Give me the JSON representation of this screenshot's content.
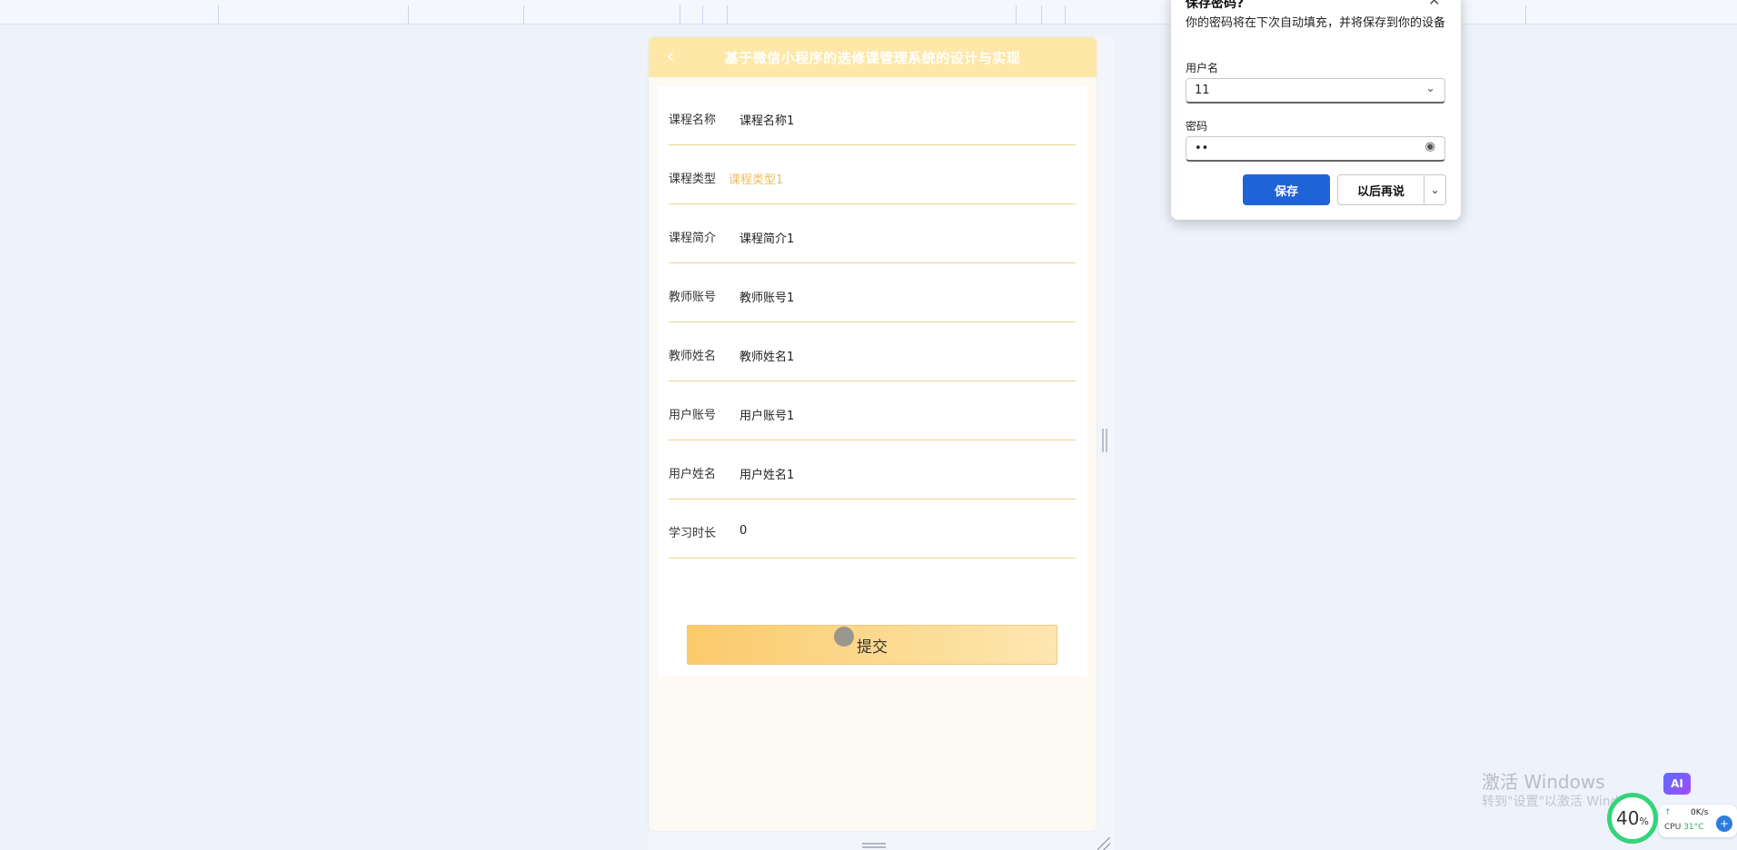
{
  "nav": {
    "back_icon": "‹",
    "title": "基于微信小程序的选修课管理系统的设计与实现"
  },
  "form": {
    "fields": [
      {
        "label": "课程名称",
        "value": "课程名称1"
      },
      {
        "label": "课程类型",
        "value": "课程类型1"
      },
      {
        "label": "课程简介",
        "value": "课程简介1"
      },
      {
        "label": "教师账号",
        "value": "教师账号1"
      },
      {
        "label": "教师姓名",
        "value": "教师姓名1"
      },
      {
        "label": "用户账号",
        "value": "用户账号1"
      },
      {
        "label": "用户姓名",
        "value": "用户姓名1"
      },
      {
        "label": "学习时长",
        "value": "0"
      }
    ],
    "submit_label": "提交",
    "accent_color": "#f2bd5d"
  },
  "password_popup": {
    "title": "保存密码?",
    "description": "你的密码将在下次自动填充，并将保存到你的设备",
    "username_label": "用户名",
    "username_value": "11",
    "password_label": "密码",
    "password_value": "••",
    "save_label": "保存",
    "later_label": "以后再说",
    "save_color": "#1f63d8"
  },
  "watermark": {
    "line1": "激活 Windows",
    "line2": "转到\"设置\"以激活 Windows。"
  },
  "tray": {
    "ai_badge": "AI",
    "gauge_value": "40",
    "gauge_unit": "%",
    "net_up_icon": "↑",
    "net_speed": "0K/s",
    "cpu_label": "CPU",
    "cpu_temp": "31°C",
    "add_icon": "+"
  }
}
